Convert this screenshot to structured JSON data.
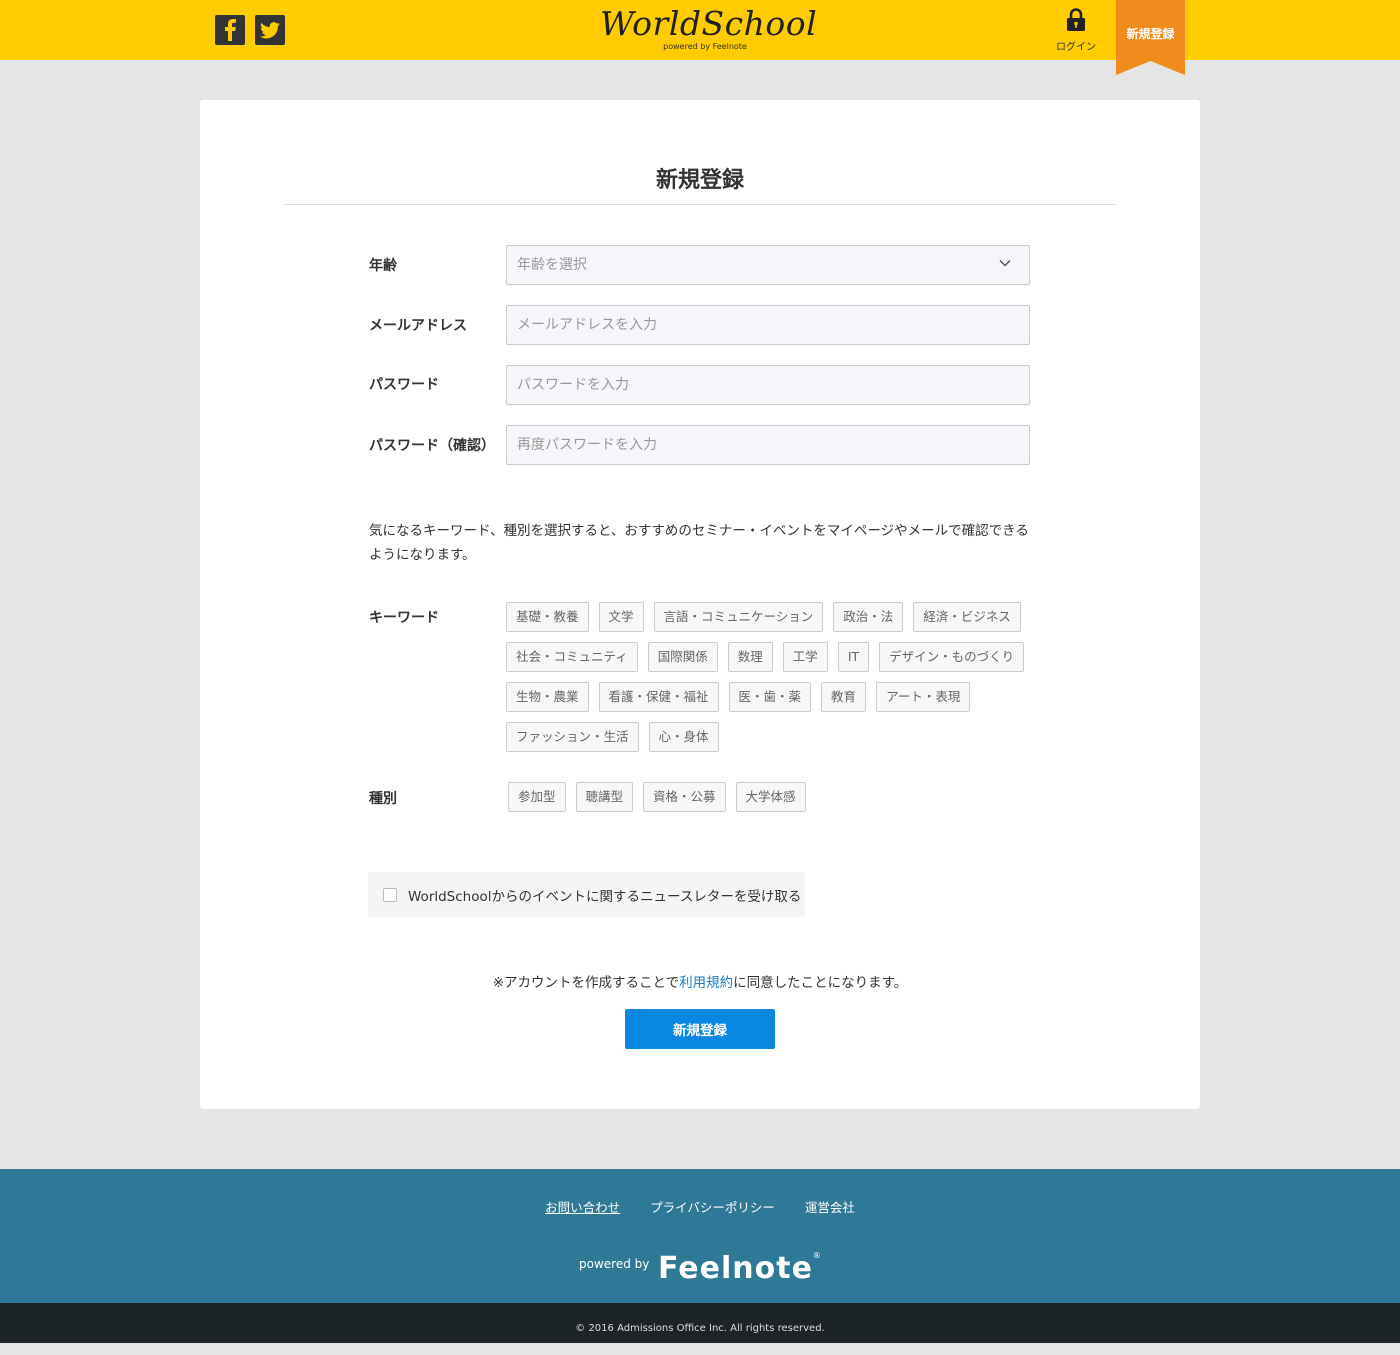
{
  "header": {
    "logo": "WorldSchool",
    "logo_sub": "powered by Feelnote",
    "login_label": "ログイン",
    "register_label": "新規登録",
    "brand_color": "#ffcc00",
    "ribbon_color": "#f08c1e"
  },
  "form": {
    "title": "新規登録",
    "age": {
      "label": "年齢",
      "placeholder": "年齢を選択"
    },
    "email": {
      "label": "メールアドレス",
      "placeholder": "メールアドレスを入力"
    },
    "password": {
      "label": "パスワード",
      "placeholder": "パスワードを入力"
    },
    "password_confirm": {
      "label": "パスワード（確認）",
      "placeholder": "再度パスワードを入力"
    },
    "description": "気になるキーワード、種別を選択すると、おすすめのセミナー・イベントをマイページやメールで確認できるようになります。",
    "keywords_label": "キーワード",
    "keywords": [
      "基礎・教養",
      "文学",
      "言語・コミュニケーション",
      "政治・法",
      "経済・ビジネス",
      "社会・コミュニティ",
      "国際関係",
      "数理",
      "工学",
      "IT",
      "デザイン・ものづくり",
      "生物・農業",
      "看護・保健・福祉",
      "医・歯・薬",
      "教育",
      "アート・表現",
      "ファッション・生活",
      "心・身体"
    ],
    "types_label": "種別",
    "types": [
      "参加型",
      "聴講型",
      "資格・公募",
      "大学体感"
    ],
    "newsletter_label": "WorldSchoolからのイベントに関するニュースレターを受け取る",
    "terms_prefix": "※アカウントを作成することで",
    "terms_link": "利用規約",
    "terms_suffix": "に同意したことになります。",
    "submit_label": "新規登録",
    "submit_color": "#0a87e0"
  },
  "footer": {
    "links": [
      "お問い合わせ",
      "プライバシーポリシー",
      "運営会社"
    ],
    "powered_by": "powered by",
    "brand": "Feelnote",
    "brand_mark": "®",
    "copyright": "© 2016 Admissions Office Inc. All rights reserved.",
    "bg_color": "#2d7996"
  }
}
